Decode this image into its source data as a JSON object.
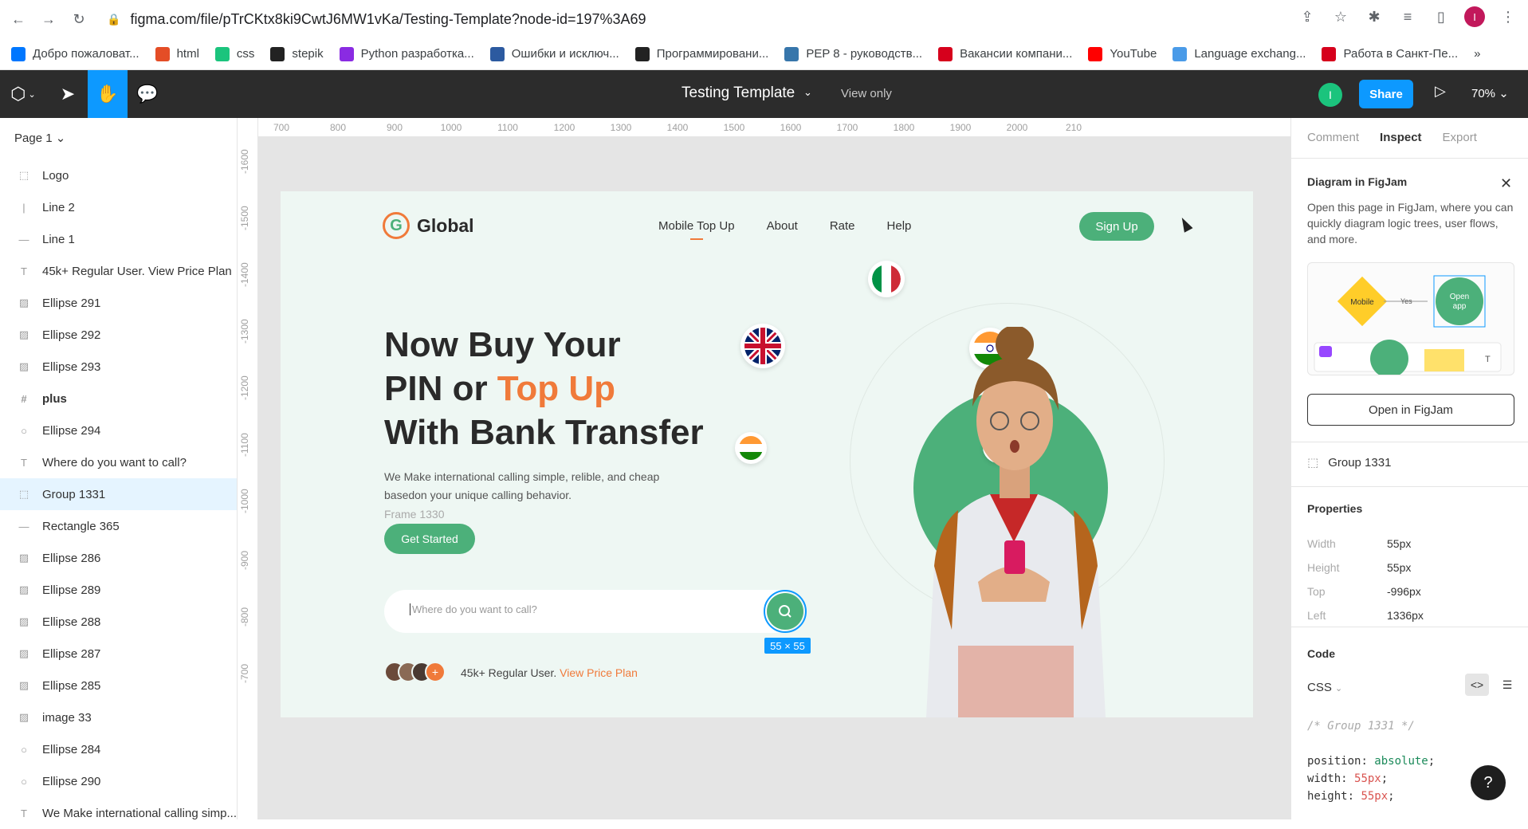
{
  "browser": {
    "url": "figma.com/file/pTrCKtx8ki9CwtJ6MW1vKa/Testing-Template?node-id=197%3A69",
    "profile_initial": "I",
    "bookmarks": [
      {
        "label": "Добро пожаловат...",
        "color": "#0077ff"
      },
      {
        "label": "html",
        "color": "#e44d26"
      },
      {
        "label": "css",
        "color": "#1bc47d"
      },
      {
        "label": "stepik",
        "color": "#222222"
      },
      {
        "label": "Python разработка...",
        "color": "#8a2be2"
      },
      {
        "label": "Ошибки и исключ...",
        "color": "#2c5aa0"
      },
      {
        "label": "Программировани...",
        "color": "#222222"
      },
      {
        "label": "PEP 8 - руководств...",
        "color": "#3776ab"
      },
      {
        "label": "Вакансии компани...",
        "color": "#d6001c"
      },
      {
        "label": "YouTube",
        "color": "#ff0000"
      },
      {
        "label": "Language exchang...",
        "color": "#4a9be8"
      },
      {
        "label": "Работа в Санкт-Пе...",
        "color": "#d6001c"
      }
    ]
  },
  "figma": {
    "title": "Testing Template",
    "mode": "View only",
    "user_initial": "I",
    "share": "Share",
    "zoom": "70%"
  },
  "left_panel": {
    "page": "Page 1",
    "layers": [
      {
        "name": "Logo",
        "icon": "frame-dashed-icon",
        "glyph": "⬚"
      },
      {
        "name": "Line 2",
        "icon": "line-vertical-icon",
        "glyph": "|"
      },
      {
        "name": "Line 1",
        "icon": "line-icon",
        "glyph": "—"
      },
      {
        "name": "45k+ Regular User. View Price Plan",
        "icon": "text-icon",
        "glyph": "T"
      },
      {
        "name": "Ellipse 291",
        "icon": "image-icon",
        "glyph": "▨"
      },
      {
        "name": "Ellipse 292",
        "icon": "image-icon",
        "glyph": "▨"
      },
      {
        "name": "Ellipse 293",
        "icon": "image-icon",
        "glyph": "▨"
      },
      {
        "name": "plus",
        "icon": "frame-hash-icon",
        "glyph": "#"
      },
      {
        "name": "Ellipse 294",
        "icon": "ellipse-icon",
        "glyph": "○"
      },
      {
        "name": "Where do you want to call?",
        "icon": "text-icon",
        "glyph": "T"
      },
      {
        "name": "Group 1331",
        "icon": "group-icon",
        "glyph": "⬚"
      },
      {
        "name": "Rectangle 365",
        "icon": "line-icon",
        "glyph": "—"
      },
      {
        "name": "Ellipse 286",
        "icon": "image-icon",
        "glyph": "▨"
      },
      {
        "name": "Ellipse 289",
        "icon": "image-icon",
        "glyph": "▨"
      },
      {
        "name": "Ellipse 288",
        "icon": "image-icon",
        "glyph": "▨"
      },
      {
        "name": "Ellipse 287",
        "icon": "image-icon",
        "glyph": "▨"
      },
      {
        "name": "Ellipse 285",
        "icon": "image-icon",
        "glyph": "▨"
      },
      {
        "name": "image 33",
        "icon": "image-icon",
        "glyph": "▨"
      },
      {
        "name": "Ellipse 284",
        "icon": "ellipse-icon",
        "glyph": "○"
      },
      {
        "name": "Ellipse 290",
        "icon": "ellipse-icon",
        "glyph": "○"
      },
      {
        "name": "We Make international calling simp...",
        "icon": "text-icon",
        "glyph": "T"
      }
    ]
  },
  "ruler": {
    "h": [
      "700",
      "800",
      "900",
      "1000",
      "1100",
      "1200",
      "1300",
      "1400",
      "1500",
      "1600",
      "1700",
      "1800",
      "1900",
      "2000",
      "210"
    ],
    "v": [
      "-1600",
      "-1500",
      "-1400",
      "-1300",
      "-1200",
      "-1100",
      "-1000",
      "-900",
      "-800",
      "-700"
    ]
  },
  "design": {
    "logo_letter": "G",
    "logo_text": "Global",
    "menu": [
      "Mobile Top Up",
      "About",
      "Rate",
      "Help"
    ],
    "signup": "Sign Up",
    "headline_line1": "Now Buy Your",
    "headline_line2a": "PIN or ",
    "headline_line2b": "Top Up",
    "headline_line3": "With Bank Transfer",
    "subtext": "We Make international calling simple, relible, and cheap basedon your unique calling behavior.",
    "frame_label": "Frame 1330",
    "get_started": "Get Started",
    "search_placeholder": "Where do you want to call?",
    "dimension_badge": "55 × 55",
    "users_text": "45k+ Regular User.",
    "users_link": "View Price Plan",
    "colors": {
      "green": "#4cb07a",
      "orange": "#f07a3a",
      "bg": "#eef7f3"
    }
  },
  "right_panel": {
    "tabs": [
      "Comment",
      "Inspect",
      "Export"
    ],
    "diagram_title": "Diagram in FigJam",
    "diagram_desc": "Open this page in FigJam, where you can quickly diagram logic trees, user flows, and more.",
    "preview": {
      "node_a": "Mobile",
      "edge": "Yes",
      "node_b": "Open app"
    },
    "open_button": "Open in FigJam",
    "selection": "Group 1331",
    "properties_title": "Properties",
    "properties": [
      {
        "k": "Width",
        "v": "55px"
      },
      {
        "k": "Height",
        "v": "55px"
      },
      {
        "k": "Top",
        "v": "-996px"
      },
      {
        "k": "Left",
        "v": "1336px"
      }
    ],
    "code_title": "Code",
    "code_lang": "CSS",
    "code_comment": "/* Group 1331 */",
    "code_lines": [
      {
        "prop": "position",
        "val": "absolute"
      },
      {
        "prop": "width",
        "val": "55px"
      },
      {
        "prop": "height",
        "val": "55px"
      }
    ]
  }
}
